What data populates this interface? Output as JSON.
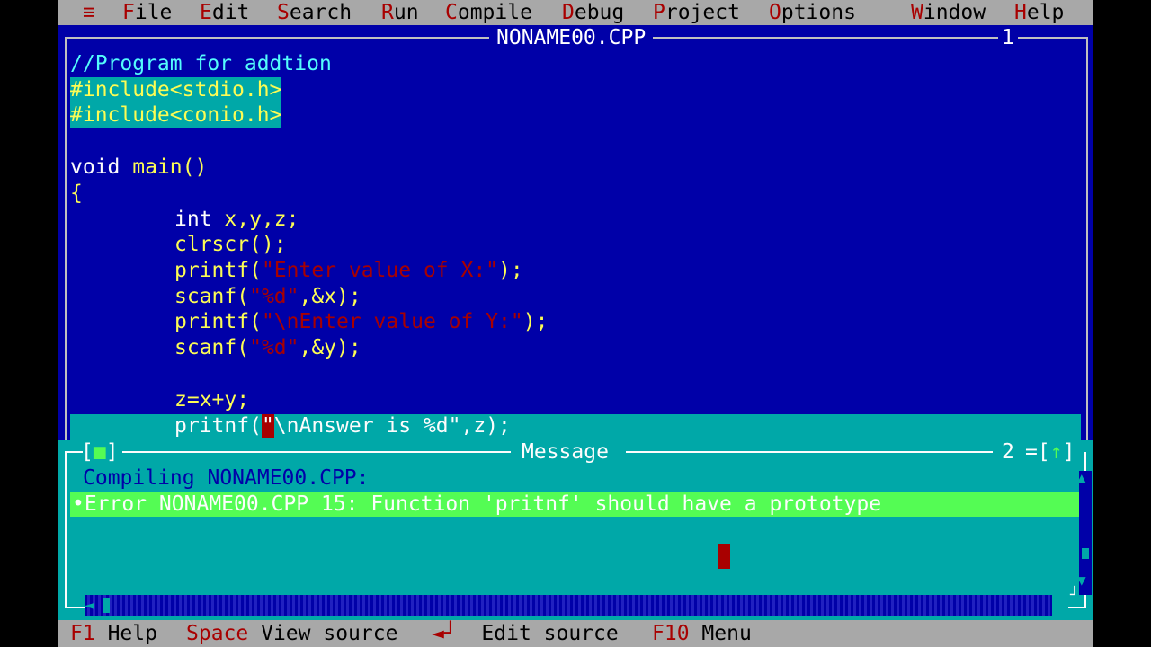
{
  "menu": {
    "system": "≡",
    "items": [
      {
        "hk": "F",
        "rest": "ile"
      },
      {
        "hk": "E",
        "rest": "dit"
      },
      {
        "hk": "S",
        "rest": "earch"
      },
      {
        "hk": "R",
        "rest": "un"
      },
      {
        "hk": "C",
        "rest": "ompile"
      },
      {
        "hk": "D",
        "rest": "ebug"
      },
      {
        "hk": "P",
        "rest": "roject"
      },
      {
        "hk": "O",
        "rest": "ptions"
      },
      {
        "hk": "W",
        "rest": "indow"
      },
      {
        "hk": "H",
        "rest": "elp"
      }
    ]
  },
  "editor": {
    "title": "NONAME00.CPP",
    "window_number": "1",
    "lines": {
      "l1": "//Program for addtion",
      "l2": "#include<stdio.h>",
      "l3": "#include<conio.h>",
      "l5a": "void",
      "l5b": " main()",
      "l6": "{",
      "l7a": "int",
      "l7b": " x,y,z;",
      "l8": "clrscr();",
      "l9a": "printf(",
      "l9s": "\"Enter value of X:\"",
      "l9b": ");",
      "l10a": "scanf(",
      "l10s": "\"%d\"",
      "l10b": ",&x);",
      "l11a": "printf(",
      "l11s": "\"\\nEnter value of Y:\"",
      "l11b": ");",
      "l12a": "scanf(",
      "l12s": "\"%d\"",
      "l12b": ",&y);",
      "l14": "z=x+y;",
      "l15a": "pritnf(",
      "l15q": "\"",
      "l15b": "\\nAnswer is %d\",z);"
    }
  },
  "message": {
    "title": "Message",
    "close_button": "[■]",
    "window_number": "2",
    "zoom_button": "[↑]",
    "compiling": "Compiling NONAME00.CPP:",
    "error": "•Error NONAME00.CPP 15: Function 'pritnf' should have a prototype"
  },
  "status": {
    "f1_key": "F1",
    "f1_label": "Help",
    "space_key": "Space",
    "space_label": "View source",
    "enter_key": "◄┘",
    "enter_label": "Edit source",
    "f10_key": "F10",
    "f10_label": "Menu"
  }
}
